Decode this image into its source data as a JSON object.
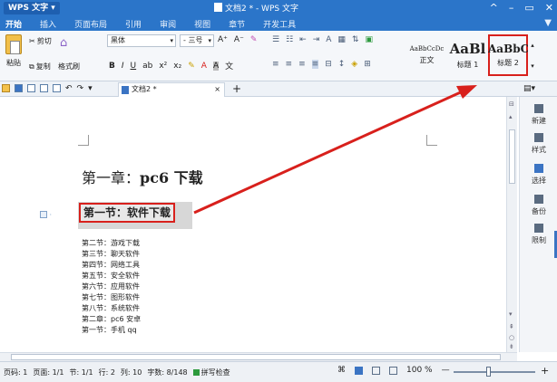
{
  "title_bar": {
    "app_name": "WPS 文字",
    "document_title": "文档2 * - WPS 文字",
    "controls": [
      "^",
      "–",
      "▭",
      "✕"
    ]
  },
  "menu": {
    "items": [
      "开始",
      "插入",
      "页面布局",
      "引用",
      "审阅",
      "视图",
      "章节",
      "开发工具"
    ],
    "active_index": 0
  },
  "ribbon": {
    "paste_label": "粘贴",
    "cut_label": "剪切",
    "copy_label": "复制",
    "format_painter_label": "格式刷",
    "font_name": "黑体",
    "font_size": "三号",
    "grow_font": "A⁺",
    "shrink_font": "A⁻",
    "bold": "B",
    "italic": "I",
    "underline": "U",
    "styles": [
      {
        "sample": "AaBbCcDc",
        "label": "正文"
      },
      {
        "sample": "AaBl",
        "label": "标题 1"
      },
      {
        "sample": "AaBbC",
        "label": "标题 2"
      }
    ]
  },
  "tab_bar": {
    "doc_tab_label": "文档2 *",
    "close_label": "×",
    "add_label": "+"
  },
  "document": {
    "chapter_prefix": "第一章：",
    "chapter_title": "pc6 下载",
    "section_title": "第一节：软件下载",
    "toc_lines": [
      "第二节：游戏下载",
      "第三节：聊天软件",
      "第四节：网络工具",
      "第五节：安全软件",
      "第六节：应用软件",
      "第七节：图形软件",
      "第八节：系统软件",
      "第二章：pc6 安卓",
      "第一节：手机 qq"
    ]
  },
  "task_pane": {
    "items": [
      "新建",
      "样式",
      "选择",
      "备份",
      "限制"
    ]
  },
  "status_bar": {
    "page_code": "页码: 1",
    "page": "页面: 1/1",
    "section": "节: 1/1",
    "row": "行: 2",
    "column": "列: 10",
    "word_count": "字数: 8/148",
    "spell_check": "拼写检查",
    "zoom": "100 %",
    "zoom_minus": "—",
    "zoom_plus": "+"
  },
  "colors": {
    "titlebar": "#2b75c9",
    "highlight_red": "#d8201c"
  }
}
